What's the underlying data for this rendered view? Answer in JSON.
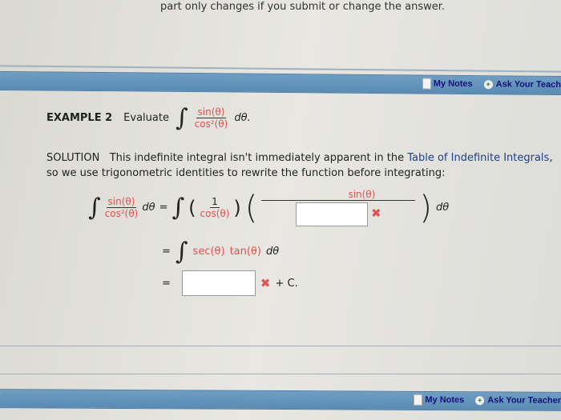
{
  "top_note": "part only changes if you submit or change the answer.",
  "toolbar": {
    "my_notes": "My Notes",
    "ask_teacher_top": "Ask Your Teach",
    "ask_teacher_bottom": "Ask Your Teacher"
  },
  "example": {
    "label": "EXAMPLE 2",
    "evaluate": "Evaluate",
    "num": "sin(θ)",
    "den": "cos²(θ)",
    "dtheta": "dθ."
  },
  "solution": {
    "label": "SOLUTION",
    "text1": "This indefinite integral isn't immediately apparent in the ",
    "link": "Table of Indefinite Integrals",
    "text2": ", so we use trigonometric identities to rewrite the function before integrating:"
  },
  "math": {
    "num": "sin(θ)",
    "den": "cos²(θ)",
    "dtheta": "dθ",
    "eq": "=",
    "one": "1",
    "cos": "cos(θ)",
    "sin": "sin(θ)",
    "sec": "sec(θ)",
    "tan": "tan(θ)",
    "plus_c": "+ C.",
    "answer1": "",
    "answer2": ""
  },
  "colors": {
    "bar": "#6f9dc2",
    "red": "#e0524f",
    "link": "#1f3f8a"
  }
}
